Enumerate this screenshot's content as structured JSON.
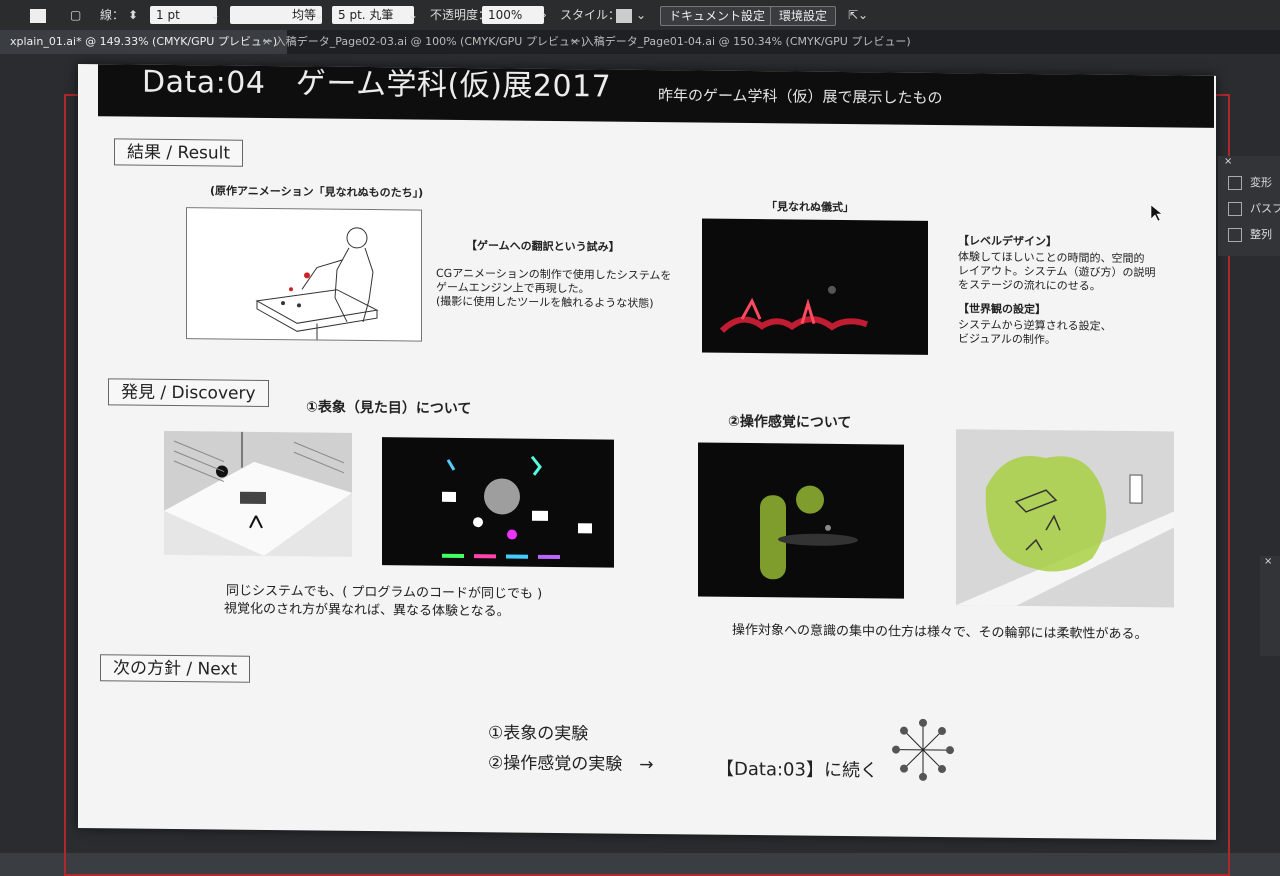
{
  "toolbar": {
    "stroke_label": "線：",
    "stroke_weight": "1 pt",
    "stroke_style": "均等",
    "brush": "5 pt. 丸筆",
    "opacity_label": "不透明度：",
    "opacity_value": "100%",
    "style_label": "スタイル：",
    "document_settings": "ドキュメント設定",
    "preferences": "環境設定"
  },
  "tabs": [
    {
      "label": "xplain_01.ai* @ 149.33% (CMYK/GPU プレビュー)"
    },
    {
      "label": "入稿データ_Page02-03.ai @ 100% (CMYK/GPU プレビュー)"
    },
    {
      "label": "入稿データ_Page01-04.ai @ 150.34% (CMYK/GPU プレビュー)"
    }
  ],
  "panel": {
    "transform": "変形",
    "pathfinder": "パスフ",
    "align": "整列"
  },
  "page": {
    "title": "Data:04　ゲーム学科(仮)展2017",
    "subtitle": "昨年のゲーム学科（仮）展で展示したもの",
    "result": {
      "heading": "結果 / Result",
      "anim_caption": "(原作アニメーション「見なれぬものたち」)",
      "translation_heading": "【ゲームへの翻訳という試み】",
      "translation_lines": [
        "CGアニメーションの制作で使用したシステムを",
        "ゲームエンジン上で再現した。",
        "(撮影に使用したツールを触れるような状態)"
      ],
      "ritual_caption": "「見なれぬ儀式」",
      "level_heading": "【レベルデザイン】",
      "level_lines": [
        "体験してほしいことの時間的、空間的",
        "レイアウト。システム（遊び方）の説明",
        "をステージの流れにのせる。"
      ],
      "world_heading": "【世界観の設定】",
      "world_lines": [
        "システムから逆算される設定、",
        "ビジュアルの制作。"
      ]
    },
    "discovery": {
      "heading": "発見 / Discovery",
      "sub1": "①表象（見た目）について",
      "sub2": "②操作感覚について",
      "note1_lines": [
        "同じシステムでも、( プログラムのコードが同じでも )",
        "視覚化のされ方が異なれば、異なる体験となる。"
      ],
      "note2": "操作対象への意識の集中の仕方は様々で、その輪郭には柔軟性がある。"
    },
    "next": {
      "heading": "次の方針 / Next",
      "item1": "①表象の実験",
      "item2": "②操作感覚の実験　→",
      "continue": "【Data:03】に続く"
    }
  },
  "colors": {
    "artboard_border": "#b0282c",
    "neon_red": "#e0203a",
    "highlight_green": "#a6cf3a"
  }
}
